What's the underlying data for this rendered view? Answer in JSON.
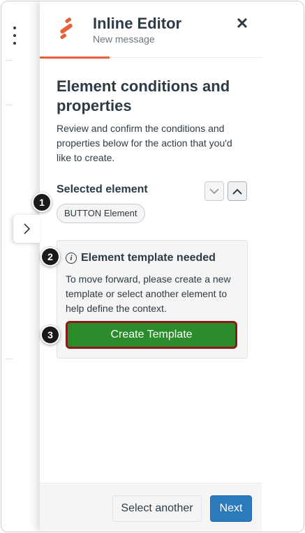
{
  "panel": {
    "title": "Inline Editor",
    "subtitle": "New message",
    "close_glyph": "✕"
  },
  "content": {
    "section_title": "Element conditions and properties",
    "description": "Review and confirm the conditions and properties below for the action that you'd like to create.",
    "selected_label": "Selected element",
    "selected_chip": "BUTTON Element"
  },
  "alert": {
    "icon_glyph": "i",
    "title": "Element template needed",
    "body": "To move forward, please create a new template or select another element to help define the context.",
    "button_label": "Create Template"
  },
  "footer": {
    "secondary_label": "Select another",
    "primary_label": "Next"
  },
  "badges": [
    "1",
    "2",
    "3"
  ],
  "icons": {
    "logo": "product-logo-icon",
    "kebab": "kebab-menu-icon",
    "expand": "chevron-right-icon",
    "chev_down": "chevron-down-icon",
    "chev_up": "chevron-up-icon",
    "info": "info-icon",
    "close": "close-icon"
  },
  "colors": {
    "accent_orange": "#e66135",
    "create_button": "#2a8c2a",
    "create_button_border": "#8b1a1a",
    "primary_button": "#2b7abc",
    "text": "#2d3b45"
  }
}
